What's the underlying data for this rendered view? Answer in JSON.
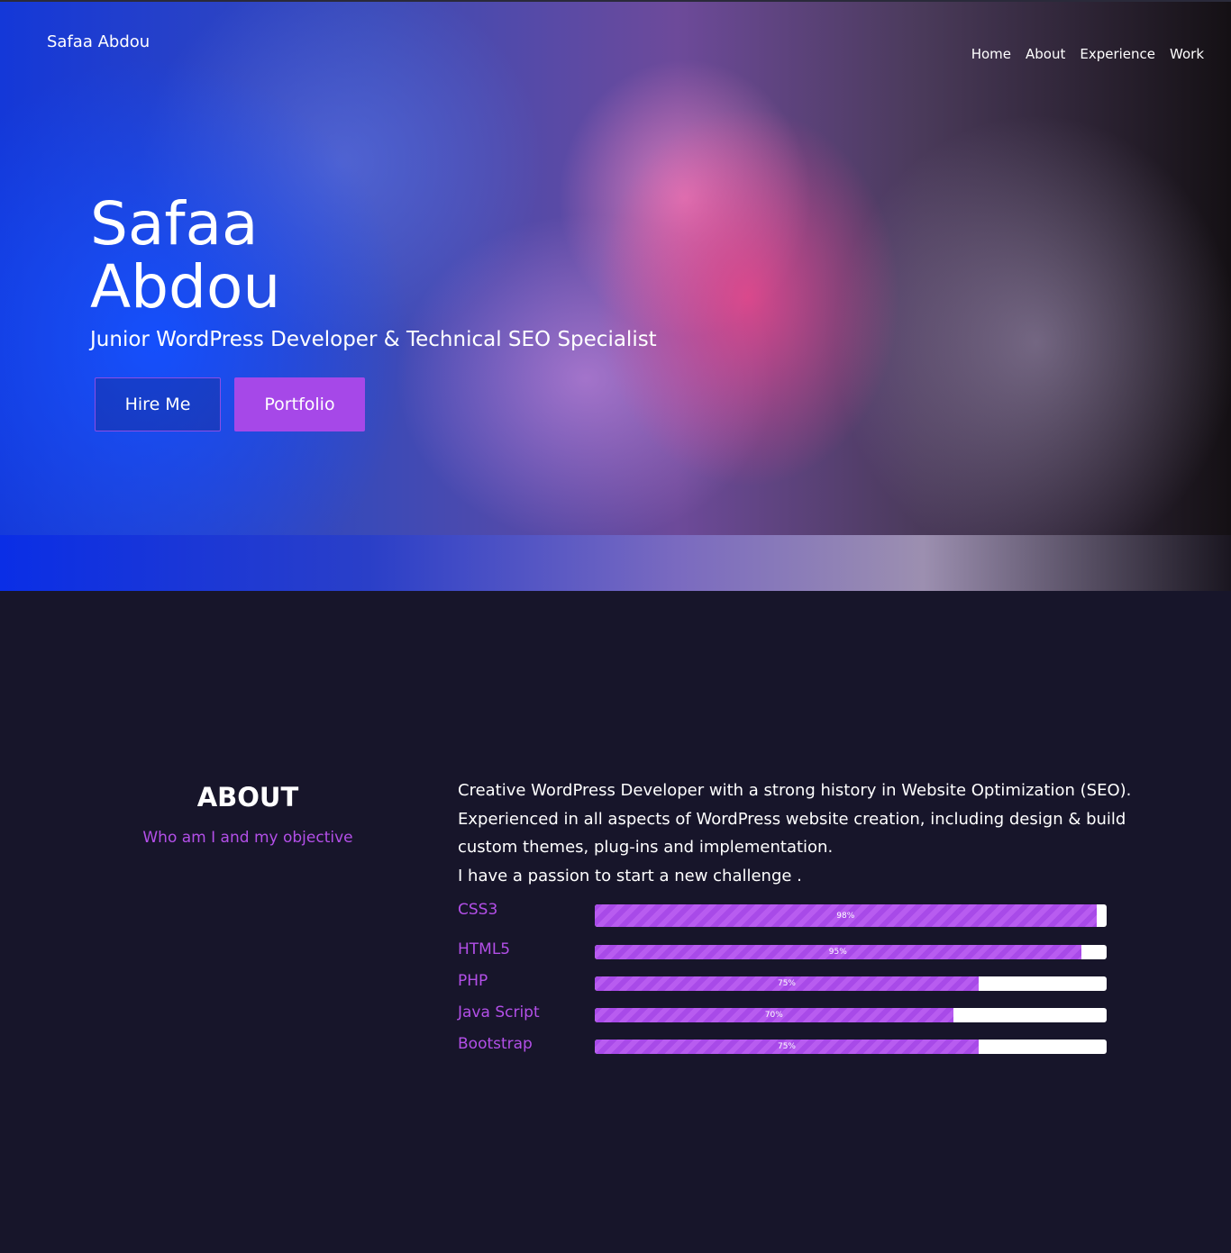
{
  "header": {
    "logo": "Safaa Abdou",
    "nav": [
      {
        "label": "Home"
      },
      {
        "label": "About"
      },
      {
        "label": "Experience"
      },
      {
        "label": "Work"
      }
    ]
  },
  "hero": {
    "name": "Safaa Abdou",
    "subtitle": "Junior WordPress Developer & Technical SEO Specialist",
    "hire_button": "Hire Me",
    "portfolio_button": "Portfolio"
  },
  "about": {
    "title": "ABOUT",
    "tagline": "Who am I and my objective",
    "paragraphs": [
      "Creative WordPress Developer with a strong history in Website Optimization (SEO).",
      "Experienced in all aspects of WordPress website creation, including design & build custom themes, plug-ins and implementation.",
      "I have a passion to start a new challenge ."
    ],
    "skills": [
      {
        "name": "CSS3",
        "percent": 98,
        "label": "98%"
      },
      {
        "name": "HTML5",
        "percent": 95,
        "label": "95%"
      },
      {
        "name": "PHP",
        "percent": 75,
        "label": "75%"
      },
      {
        "name": "Java Script",
        "percent": 70,
        "label": "70%"
      },
      {
        "name": "Bootstrap",
        "percent": 75,
        "label": "75%"
      }
    ]
  },
  "colors": {
    "accent": "#a648e8",
    "background": "#17152a"
  }
}
